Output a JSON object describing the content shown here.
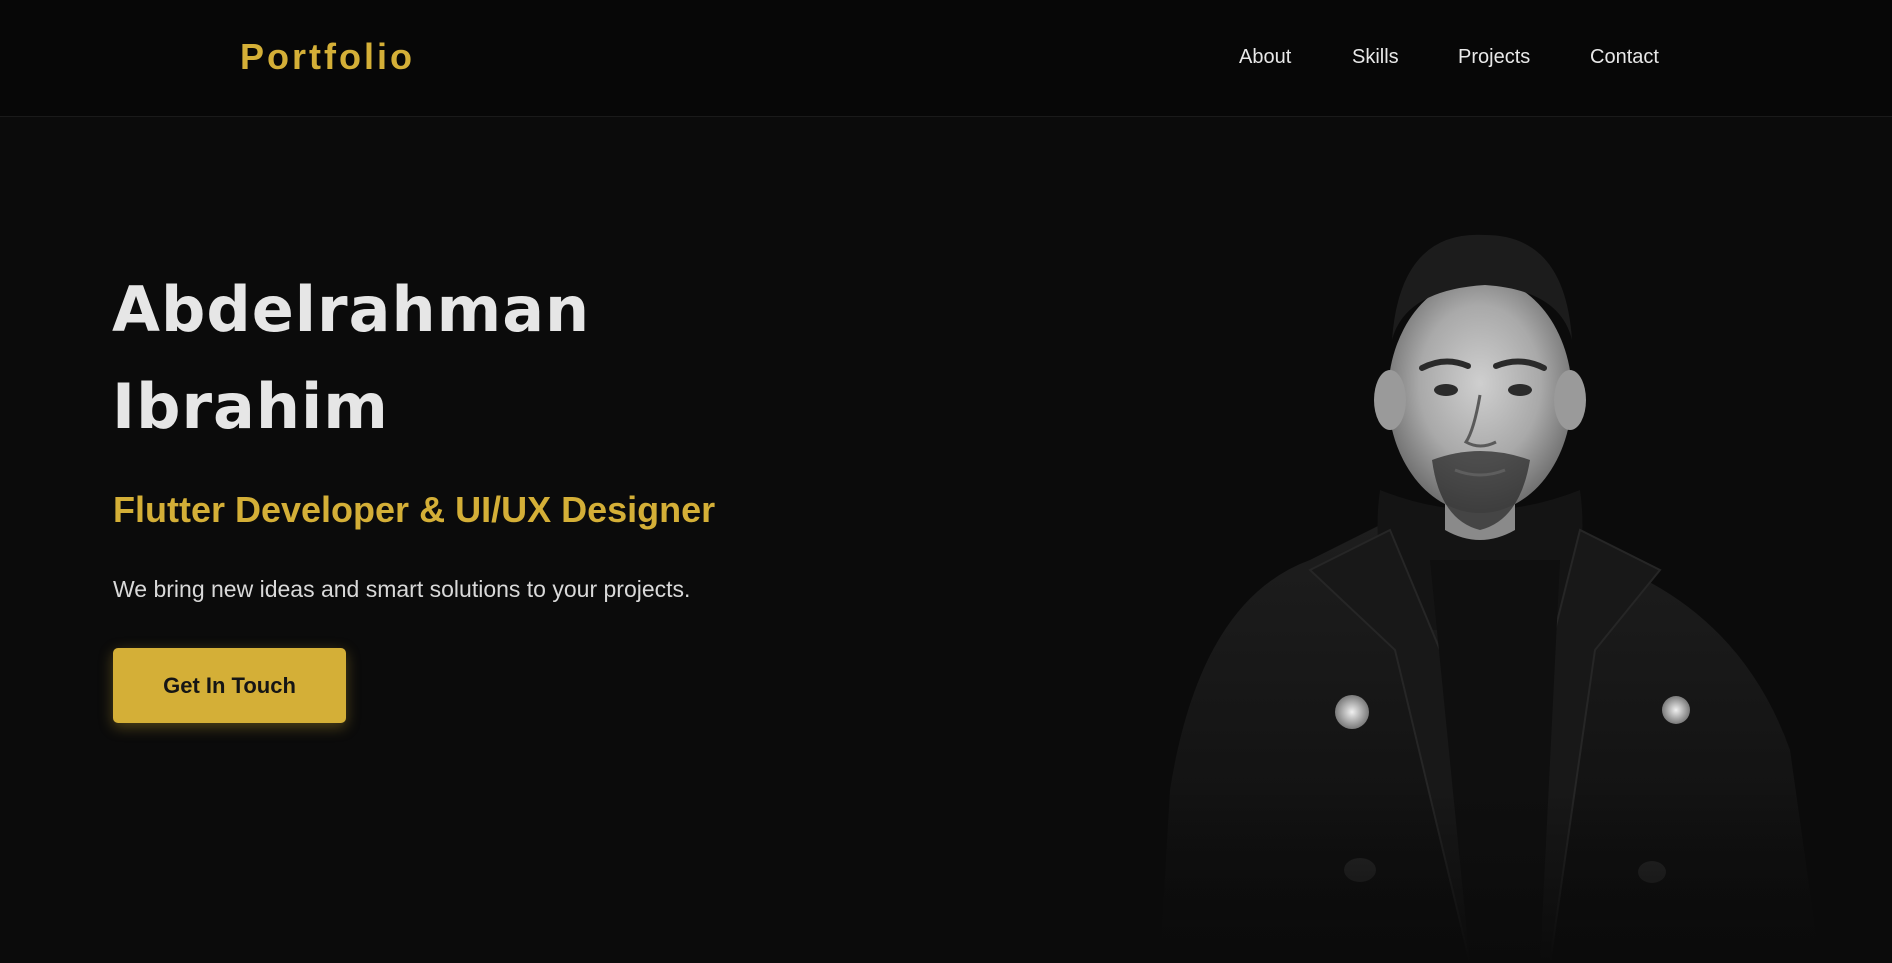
{
  "header": {
    "brand": "Portfolio",
    "nav": [
      {
        "label": "About"
      },
      {
        "label": "Skills"
      },
      {
        "label": "Projects"
      },
      {
        "label": "Contact"
      }
    ]
  },
  "hero": {
    "name_line1": "Abdelrahman",
    "name_line2": "Ibrahim",
    "subtitle": "Flutter Developer & UI/UX Designer",
    "tagline": "We bring new ideas and smart solutions to your projects.",
    "cta_label": "Get In Touch"
  },
  "portrait": {
    "style": "black-and-white photo of a man in a dark coat and hoodie"
  },
  "colors": {
    "accent": "#d4af37",
    "background": "#0b0b0b",
    "header_bg": "#070707",
    "text": "#e6e6e6"
  }
}
